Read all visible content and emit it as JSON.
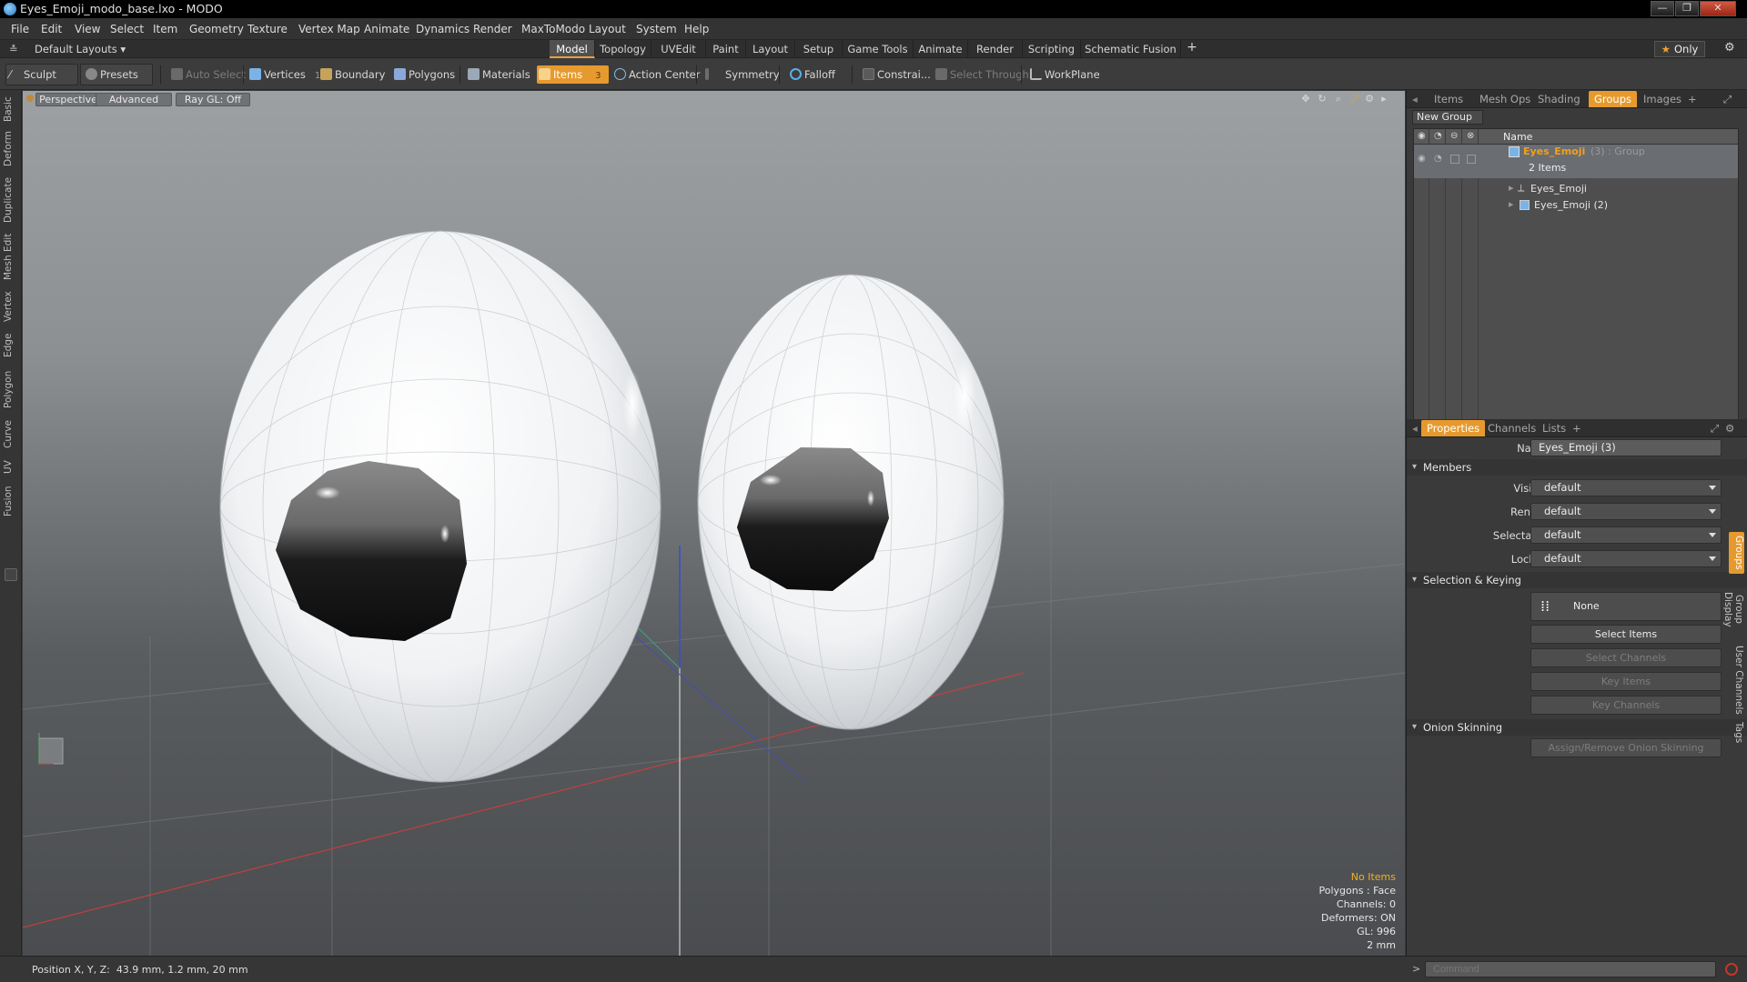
{
  "window": {
    "title": "Eyes_Emoji_modo_base.lxo - MODO",
    "minimize": "—",
    "maximize": "❐",
    "close": "✕"
  },
  "menu": [
    "File",
    "Edit",
    "View",
    "Select",
    "Item",
    "Geometry",
    "Texture",
    "Vertex Map",
    "Animate",
    "Dynamics",
    "Render",
    "MaxToModo",
    "Layout",
    "System",
    "Help"
  ],
  "layoutbar": {
    "layouts_label": "Default Layouts ▾",
    "tabs": [
      "Model",
      "Topology",
      "UVEdit",
      "Paint",
      "Layout",
      "Setup",
      "Game Tools",
      "Animate",
      "Render",
      "Scripting",
      "Schematic Fusion"
    ],
    "active_tab": "Model",
    "add": "+",
    "only_label": "Only"
  },
  "toolbar": {
    "sculpt": "Sculpt",
    "presets": "Presets",
    "auto_select": "Auto Select",
    "vertices": "Vertices",
    "vertices_count": "1",
    "boundary": "Boundary",
    "polygons": "Polygons",
    "materials": "Materials",
    "items": "Items",
    "items_count": "3",
    "action_center": "Action Center",
    "symmetry": "Symmetry",
    "falloff": "Falloff",
    "constraints": "Constrai...",
    "select_through": "Select Through",
    "workplane": "WorkPlane"
  },
  "left_tabs": [
    "Basic",
    "Deform",
    "Duplicate",
    "Mesh Edit",
    "Vertex",
    "Edge",
    "Polygon",
    "Curve",
    "UV",
    "Fusion"
  ],
  "viewport": {
    "view_mode": "Perspective",
    "shading": "Advanced",
    "raygl": "Ray GL: Off",
    "info": {
      "selection": "No Items",
      "polygons": "Polygons : Face",
      "channels": "Channels: 0",
      "deformers": "Deformers: ON",
      "gl": "GL: 996",
      "unit": "2 mm"
    }
  },
  "groups_panel": {
    "tabs": [
      "Items",
      "Mesh Ops",
      "Shading",
      "Groups",
      "Images"
    ],
    "active_tab": "Groups",
    "add": "+",
    "new_group": "New Group",
    "column_name": "Name",
    "group": {
      "name": "Eyes_Emoji",
      "suffix": "(3) : Group",
      "count": "2 Items",
      "children": [
        "Eyes_Emoji",
        "Eyes_Emoji (2)"
      ]
    }
  },
  "properties_panel": {
    "tabs": [
      "Properties",
      "Channels",
      "Lists"
    ],
    "active_tab": "Properties",
    "add": "+",
    "name_label": "Name",
    "name_value": "Eyes_Emoji (3)",
    "members_section": "Members",
    "members": [
      {
        "label": "Visible",
        "value": "default"
      },
      {
        "label": "Render",
        "value": "default"
      },
      {
        "label": "Selectable",
        "value": "default"
      },
      {
        "label": "Locked",
        "value": "default"
      }
    ],
    "selection_section": "Selection & Keying",
    "none_label": "None",
    "select_items": "Select Items",
    "select_channels": "Select Channels",
    "key_items": "Key Items",
    "key_channels": "Key Channels",
    "onion_section": "Onion Skinning",
    "onion_button": "Assign/Remove Onion Skinning",
    "side_tabs": [
      "Groups",
      "Group Display",
      "User Channels",
      "Tags"
    ]
  },
  "status": {
    "position_label": "Position X, Y, Z:",
    "position_value": "43.9 mm, 1.2 mm, 20 mm",
    "command_placeholder": "Command"
  },
  "colors": {
    "accent": "#e69a2e",
    "group_name": "#f0a020",
    "viewport_top": "#9da0a3",
    "viewport_bottom": "#4a4c4f"
  }
}
